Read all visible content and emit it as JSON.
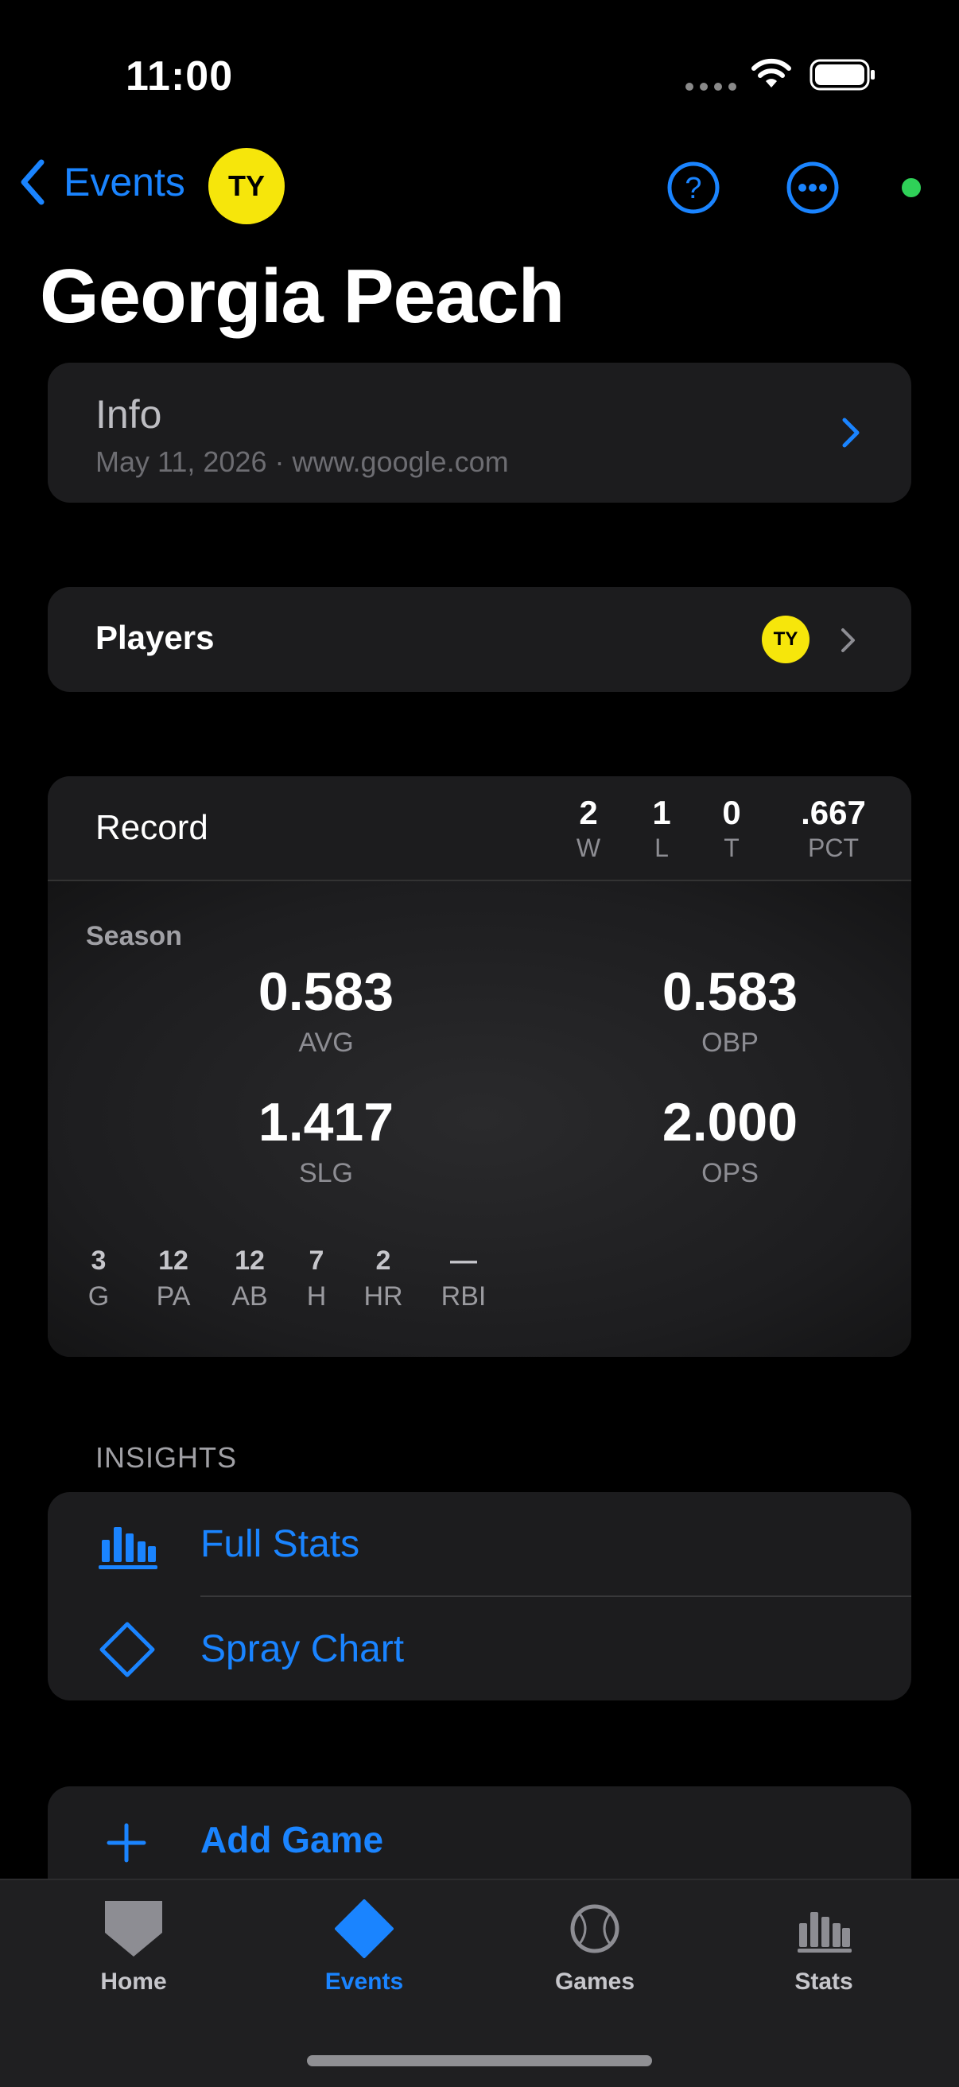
{
  "status_bar": {
    "time": "11:00"
  },
  "nav": {
    "back_label": "Events",
    "avatar_initials": "TY"
  },
  "page_title": "Georgia Peach",
  "info": {
    "title": "Info",
    "subtitle": "May 11, 2026 · www.google.com"
  },
  "players": {
    "label": "Players",
    "avatar_initials": "TY"
  },
  "record": {
    "label": "Record",
    "columns": [
      {
        "value": "2",
        "label": "W"
      },
      {
        "value": "1",
        "label": "L"
      },
      {
        "value": "0",
        "label": "T"
      },
      {
        "value": ".667",
        "label": "PCT"
      }
    ]
  },
  "season": {
    "label": "Season",
    "big_stats": [
      {
        "value": "0.583",
        "label": "AVG"
      },
      {
        "value": "0.583",
        "label": "OBP"
      },
      {
        "value": "1.417",
        "label": "SLG"
      },
      {
        "value": "2.000",
        "label": "OPS"
      }
    ],
    "small_stats": [
      {
        "value": "3",
        "label": "G"
      },
      {
        "value": "12",
        "label": "PA"
      },
      {
        "value": "12",
        "label": "AB"
      },
      {
        "value": "7",
        "label": "H"
      },
      {
        "value": "2",
        "label": "HR"
      },
      {
        "value": "—",
        "label": "RBI"
      }
    ]
  },
  "insights": {
    "header": "INSIGHTS",
    "items": [
      {
        "label": "Full Stats",
        "icon": "bar-chart-icon"
      },
      {
        "label": "Spray Chart",
        "icon": "diamond-icon"
      }
    ]
  },
  "add_game": {
    "label": "Add Game"
  },
  "tabbar": {
    "tabs": [
      {
        "label": "Home",
        "icon": "home-plate-icon",
        "active": false
      },
      {
        "label": "Events",
        "icon": "diamond-filled-icon",
        "active": true
      },
      {
        "label": "Games",
        "icon": "baseball-icon",
        "active": false
      },
      {
        "label": "Stats",
        "icon": "bar-chart-icon",
        "active": false
      }
    ]
  },
  "colors": {
    "accent": "#1a84ff",
    "avatar": "#f6e60b",
    "online": "#2fd158",
    "card": "#1c1c1e"
  }
}
